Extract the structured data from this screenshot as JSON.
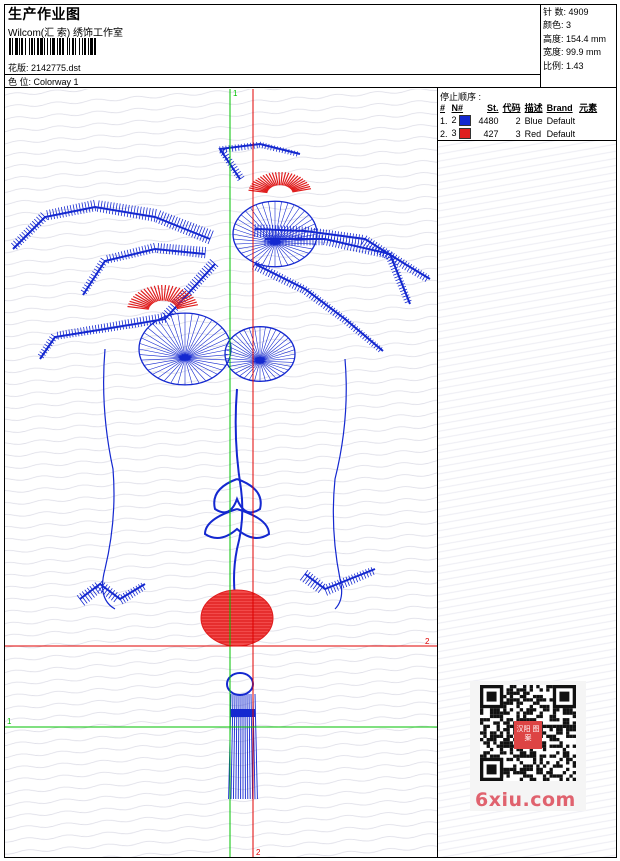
{
  "header": {
    "title": "生产作业图",
    "company": "Wilcom(汇 索) 绣饰工作室",
    "file_label": "花版: 2142775.dst",
    "colorway_label": "色 位:  Colorway 1"
  },
  "stats": [
    {
      "label": "针 数",
      "value": "4909"
    },
    {
      "label": "颜色",
      "value": "3"
    },
    {
      "label": "高度",
      "value": "154.4 mm"
    },
    {
      "label": "宽度",
      "value": "99.9 mm"
    },
    {
      "label": "比例",
      "value": "1.43"
    }
  ],
  "stop_sequence": {
    "title": "停止顺序 :",
    "headers": [
      "#",
      "N#",
      "St.",
      "代码",
      "描述",
      "Brand",
      "元素"
    ],
    "rows": [
      {
        "index": "1.",
        "n": "2",
        "color": "#1428d0",
        "stitches": "4480",
        "code": "2",
        "desc": "Blue",
        "brand": "Default",
        "element": ""
      },
      {
        "index": "2.",
        "n": "3",
        "color": "#e01e1e",
        "stitches": "427",
        "code": "3",
        "desc": "Red",
        "brand": "Default",
        "element": ""
      }
    ]
  },
  "canvas": {
    "axis_labels": {
      "green_v": "1",
      "green_h": "1",
      "red_h": "2",
      "red_v": "2"
    },
    "colors": {
      "blue": "#1428d0",
      "red": "#e01e1e",
      "green_axis": "#00c000",
      "red_axis": "#e00000"
    }
  },
  "watermark": "6xiu.com",
  "qr_stamp": "汉阳 图案"
}
